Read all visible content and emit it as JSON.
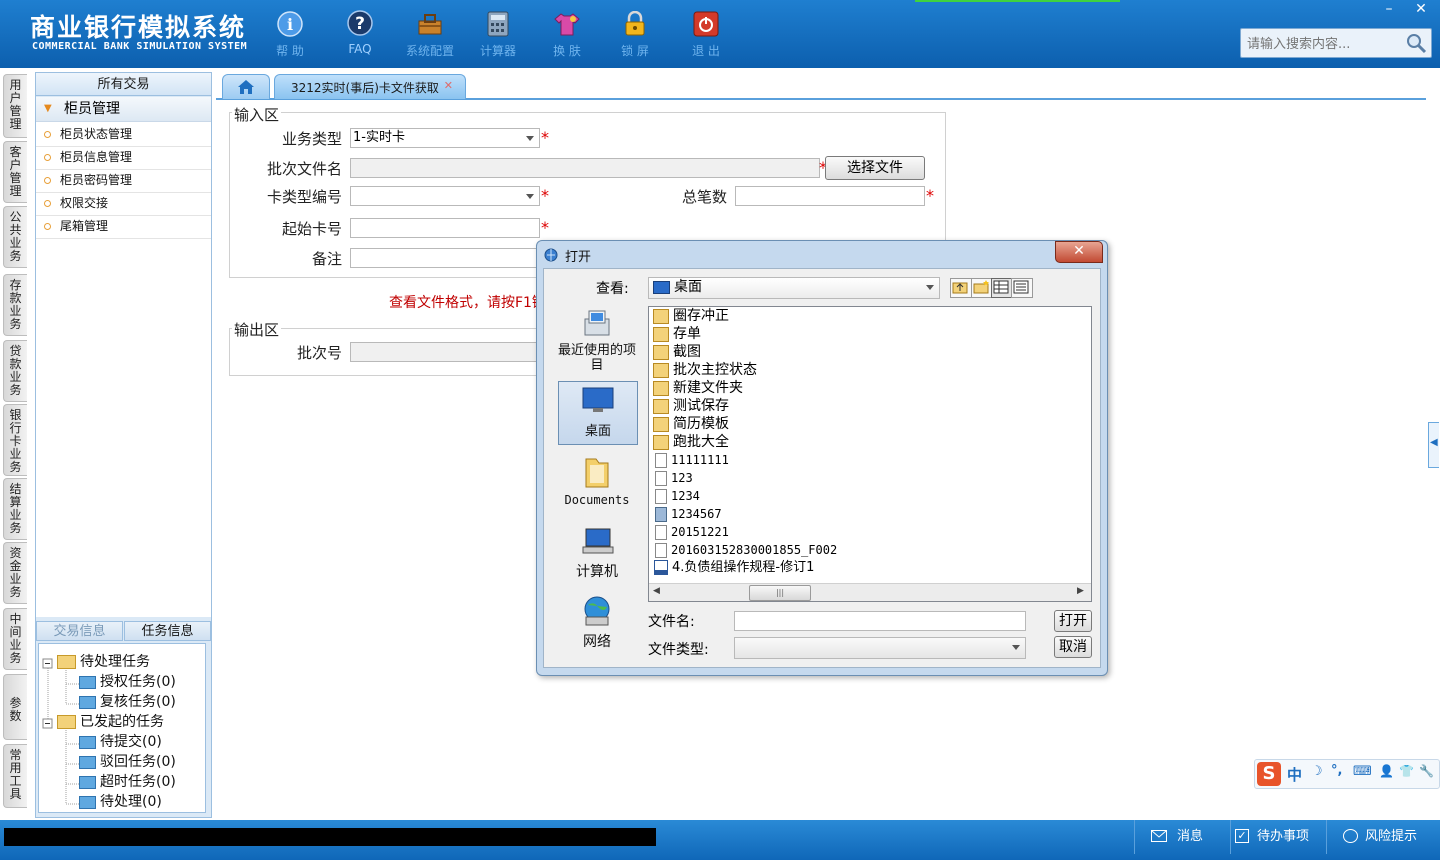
{
  "app": {
    "title_cn": "商业银行模拟系统",
    "title_en": "COMMERCIAL BANK SIMULATION SYSTEM",
    "toolbar": [
      {
        "label": "帮 助",
        "icon": "help-icon"
      },
      {
        "label": "FAQ",
        "icon": "faq-icon"
      },
      {
        "label": "系统配置",
        "icon": "toolbox-icon"
      },
      {
        "label": "计算器",
        "icon": "calculator-icon"
      },
      {
        "label": "换 肤",
        "icon": "shirt-icon"
      },
      {
        "label": "锁 屏",
        "icon": "lock-icon"
      },
      {
        "label": "退 出",
        "icon": "power-icon"
      }
    ],
    "window_controls": {
      "minimize": "–",
      "close": "✕"
    },
    "search_placeholder": "请输入搜索内容..."
  },
  "side_tabs": [
    "用户管理",
    "客户管理",
    "公共业务",
    "存款业务",
    "贷款业务",
    "银行卡业务",
    "结算业务",
    "资金业务",
    "中间业务",
    "参数",
    "常用工具"
  ],
  "menu": {
    "header": "所有交易",
    "group": "柜员管理",
    "items": [
      "柜员状态管理",
      "柜员信息管理",
      "柜员密码管理",
      "权限交接",
      "尾箱管理"
    ]
  },
  "tasks": {
    "tabs": [
      "交易信息",
      "任务信息"
    ],
    "pending": {
      "label": "待处理任务",
      "children": [
        "授权任务(0)",
        "复核任务(0)"
      ]
    },
    "initiated": {
      "label": "已发起的任务",
      "children": [
        "待提交(0)",
        "驳回任务(0)",
        "超时任务(0)",
        "待处理(0)"
      ]
    }
  },
  "content_tab": {
    "label": "3212实时(事后)卡文件获取",
    "close": "✕"
  },
  "form": {
    "input_legend": "输入区",
    "business_type_label": "业务类型",
    "business_type_value": "1-实时卡",
    "batch_file_label": "批次文件名",
    "choose_file_button": "选择文件",
    "card_type_label": "卡类型编号",
    "total_count_label": "总笔数",
    "start_card_label": "起始卡号",
    "remark_label": "备注",
    "hint": "查看文件格式，请按F1键",
    "required_mark": "*",
    "output_legend": "输出区",
    "batch_no_label": "批次号"
  },
  "dialog": {
    "title": "打开",
    "close": "✕",
    "lookin_label": "查看:",
    "lookin_value": "桌面",
    "places": [
      "最近使用的项目",
      "桌面",
      "Documents",
      "计算机",
      "网络"
    ],
    "files": [
      {
        "name": "圈存冲正",
        "type": "folder"
      },
      {
        "name": "存单",
        "type": "folder"
      },
      {
        "name": "截图",
        "type": "folder"
      },
      {
        "name": "批次主控状态",
        "type": "folder"
      },
      {
        "name": "新建文件夹",
        "type": "folder"
      },
      {
        "name": "测试保存",
        "type": "folder"
      },
      {
        "name": "简历模板",
        "type": "folder"
      },
      {
        "name": "跑批大全",
        "type": "folder"
      },
      {
        "name": "11111111",
        "type": "file"
      },
      {
        "name": "123",
        "type": "file"
      },
      {
        "name": "1234",
        "type": "file"
      },
      {
        "name": "1234567",
        "type": "image"
      },
      {
        "name": "20151221",
        "type": "file"
      },
      {
        "name": "201603152830001855_F002",
        "type": "file"
      },
      {
        "name": "4.负债组操作规程-修订1",
        "type": "word"
      }
    ],
    "scroll_grip": "|||",
    "filename_label": "文件名:",
    "filename_value": "",
    "filetype_label": "文件类型:",
    "filetype_value": "",
    "open_button": "打开",
    "cancel_button": "取消"
  },
  "ime": {
    "brand": "S",
    "chars": [
      "中",
      "☽",
      "°,",
      "⌨",
      "👤",
      "👕",
      "🔧"
    ]
  },
  "statusbar": {
    "message": "消息",
    "todo": "待办事项",
    "risk": "风险提示"
  },
  "colors": {
    "header_blue": "#1f7fd0",
    "required_red": "#dd0000",
    "hint_red": "#c00000"
  }
}
